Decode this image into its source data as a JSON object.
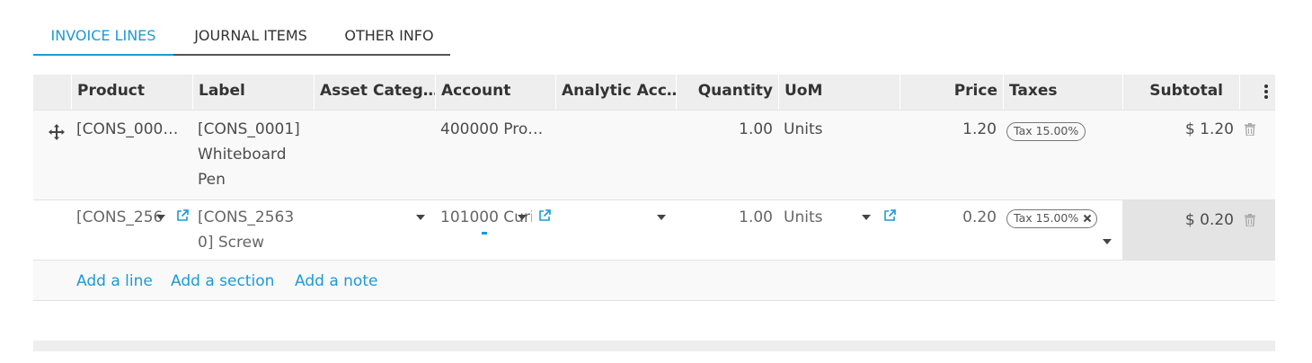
{
  "tabs": [
    {
      "label": "INVOICE LINES",
      "active": true
    },
    {
      "label": "JOURNAL ITEMS",
      "active": false
    },
    {
      "label": "OTHER INFO",
      "active": false
    }
  ],
  "columns": {
    "product": "Product",
    "label": "Label",
    "asset_category": "Asset Categ…",
    "account": "Account",
    "analytic": "Analytic Acc…",
    "quantity": "Quantity",
    "uom": "UoM",
    "price": "Price",
    "taxes": "Taxes",
    "subtotal": "Subtotal"
  },
  "rows": [
    {
      "product": "[CONS_000…",
      "label_lines": [
        "[CONS_0001]",
        "Whiteboard",
        "Pen"
      ],
      "asset_category": "",
      "account": "400000 Pro…",
      "analytic": "",
      "quantity": "1.00",
      "uom": "Units",
      "price": "1.20",
      "tax": "Tax 15.00%",
      "subtotal": "$ 1.20"
    },
    {
      "product": "[CONS_256",
      "label_lines": [
        "[CONS_2563",
        "0] Screw"
      ],
      "asset_category": "",
      "account": "101000 Curi",
      "analytic": "",
      "quantity": "1.00",
      "uom": "Units",
      "price": "0.20",
      "tax": "Tax 15.00%",
      "subtotal": "$ 0.20"
    }
  ],
  "actions": {
    "add_line": "Add a line",
    "add_section": "Add a section",
    "add_note": "Add a note"
  },
  "colors": {
    "accent": "#1c9ad6",
    "header_bg": "#eeeeee",
    "row_bg": "#f9f9f9",
    "edit_subtotal_bg": "#e4e4e4"
  },
  "icons": {
    "drag": "drag-handle-icon",
    "external": "external-link-icon",
    "trash": "trash-icon",
    "dropdown": "caret-down-icon",
    "remove_tag": "close-icon",
    "menu": "kebab-menu-icon"
  }
}
